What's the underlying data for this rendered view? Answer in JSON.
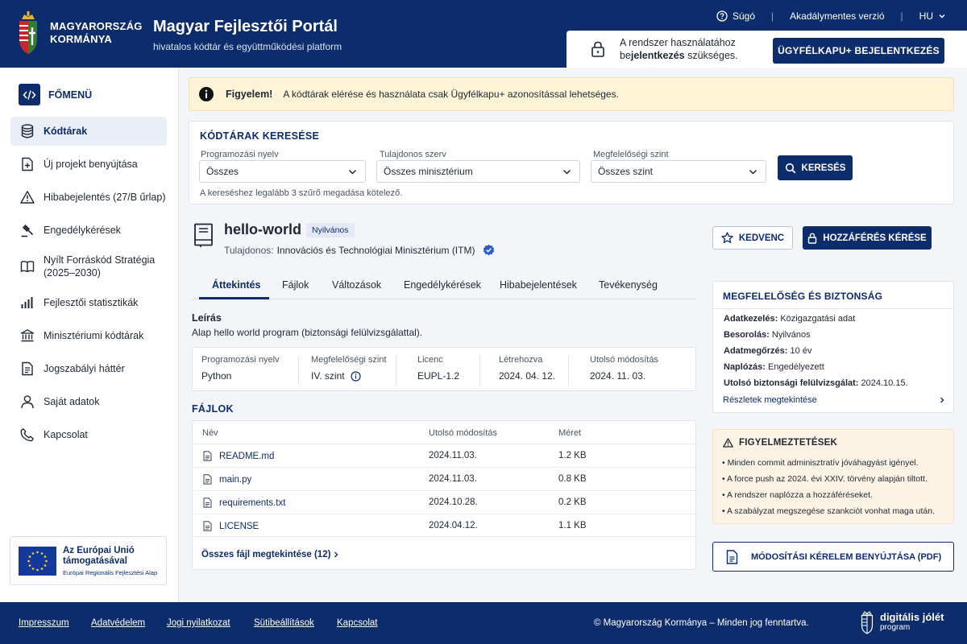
{
  "header": {
    "gov_line1": "MAGYARORSZÁG",
    "gov_line2": "KORMÁNYA",
    "portal_title": "Magyar Fejlesztői Portál",
    "portal_subtitle": "hivatalos kódtár és együttműködési platform",
    "help": "Súgó",
    "accessible": "Akadálymentes verzió",
    "language": "HU",
    "login_notice_line1": "A rendszer használatához",
    "login_notice_pre": "be",
    "login_notice_bold": "jelentkezés",
    "login_notice_post": " szükséges.",
    "login_button": "ÜGYFÉLKAPU+ BEJELENTKEZÉS"
  },
  "sidebar": {
    "menu_title": "FŐMENÜ",
    "items": [
      {
        "label": "Kódtárak",
        "icon": "database-icon",
        "active": true
      },
      {
        "label": "Új projekt benyújtása",
        "icon": "file-plus-icon"
      },
      {
        "label": "Hibabejelentés (27/B űrlap)",
        "icon": "warning-icon"
      },
      {
        "label": "Engedélykérések",
        "icon": "gavel-icon"
      },
      {
        "label": "Nyílt Forráskód Stratégia (2025–2030)",
        "icon": "book-icon"
      },
      {
        "label": "Fejlesztői statisztikák",
        "icon": "bar-chart-icon"
      },
      {
        "label": "Minisztériumi kódtárak",
        "icon": "bank-icon"
      },
      {
        "label": "Jogszabályi háttér",
        "icon": "document-icon"
      },
      {
        "label": "Saját adatok",
        "icon": "user-icon"
      },
      {
        "label": "Kapcsolat",
        "icon": "phone-icon"
      }
    ],
    "eu": {
      "line1": "Az Európai Unió",
      "line2": "támogatásával",
      "line3": "Európai Regionális Fejlesztési Alap"
    }
  },
  "alert": {
    "title": "Figyelem!",
    "message": "A kódtárak elérése és használata csak Ügyfélkapu+ azonosítással lehetséges."
  },
  "search": {
    "title": "KÓDTÁRAK KERESÉSE",
    "filters": [
      {
        "label": "Programozási nyelv",
        "value": "Összes"
      },
      {
        "label": "Tulajdonos szerv",
        "value": "Összes minisztérium"
      },
      {
        "label": "Megfelelőségi szint",
        "value": "Összes szint"
      }
    ],
    "button": "KERESÉS",
    "note": "A kereséshez legalább 3 szűrő megadása kötelező."
  },
  "repo": {
    "name": "hello-world",
    "visibility": "Nyilvános",
    "owner_label": "Tulajdonos:",
    "owner": "Innovációs és Technológiai Minisztérium (ITM)",
    "favorite_button": "KEDVENC",
    "access_button": "HOZZÁFÉRÉS KÉRÉSE",
    "tabs": [
      "Áttekintés",
      "Fájlok",
      "Változások",
      "Engedélykérések",
      "Hibabejelentések",
      "Tevékenység"
    ],
    "active_tab": "Áttekintés",
    "description_title": "Leírás",
    "description": "Alap hello world program (biztonsági felülvizsgálattal).",
    "meta": [
      {
        "label": "Programozási nyelv",
        "value": "Python"
      },
      {
        "label": "Megfelelőségi szint",
        "value": "IV. szint"
      },
      {
        "label": "Licenc",
        "value": "EUPL-1.2"
      },
      {
        "label": "Létrehozva",
        "value": "2024. 04. 12."
      },
      {
        "label": "Utolsó módosítás",
        "value": "2024. 11. 03."
      }
    ]
  },
  "files": {
    "title": "FÁJLOK",
    "columns": [
      "Név",
      "Utolsó módosítás",
      "Méret"
    ],
    "rows": [
      {
        "name": "README.md",
        "date": "2024.11.03.",
        "size": "1.2 KB"
      },
      {
        "name": "main.py",
        "date": "2024.11.03.",
        "size": "0.8 KB"
      },
      {
        "name": "requirements.txt",
        "date": "2024.10.28.",
        "size": "0.2 KB"
      },
      {
        "name": "LICENSE",
        "date": "2024.04.12.",
        "size": "1.1 KB"
      }
    ],
    "view_all": "Összes fájl megtekintése (12)"
  },
  "compliance": {
    "title": "MEGFELELŐSÉG ÉS BIZTONSÁG",
    "items": [
      {
        "key": "Adatkezelés:",
        "value": "Közigazgatási adat"
      },
      {
        "key": "Besorolás:",
        "value": "Nyilvános"
      },
      {
        "key": "Adatmegőrzés:",
        "value": "10 év"
      },
      {
        "key": "Naplózás:",
        "value": "Engedélyezett"
      },
      {
        "key": "Utolsó biztonsági felülvizsgálat:",
        "value": "2024.10.15."
      }
    ],
    "details_link": "Részletek megtekintése"
  },
  "warnings": {
    "title": "FIGYELMEZTETÉSEK",
    "items": [
      "Minden commit adminisztratív jóváhagyást igényel.",
      "A force push az 2024. évi XXIV. törvény alapján tiltott.",
      "A rendszer naplózza a hozzáféréseket.",
      "A szabályzat megszegése szankciót vonhat maga után."
    ]
  },
  "pdf_button": "MÓDOSÍTÁSI KÉRELEM BENYÚJTÁSA (PDF)",
  "footer": {
    "links": [
      "Impresszum",
      "Adatvédelem",
      "Jogi nyilatkozat",
      "Sütibeállítások",
      "Kapcsolat"
    ],
    "copyright": "© Magyarország Kormánya – Minden jog fenntartva.",
    "brand_line1": "digitális jólét",
    "brand_line2": "program"
  },
  "colors": {
    "primary": "#0d2c6b",
    "alert_bg": "#fdf3d6",
    "warning_bg": "#fdf3e4"
  }
}
